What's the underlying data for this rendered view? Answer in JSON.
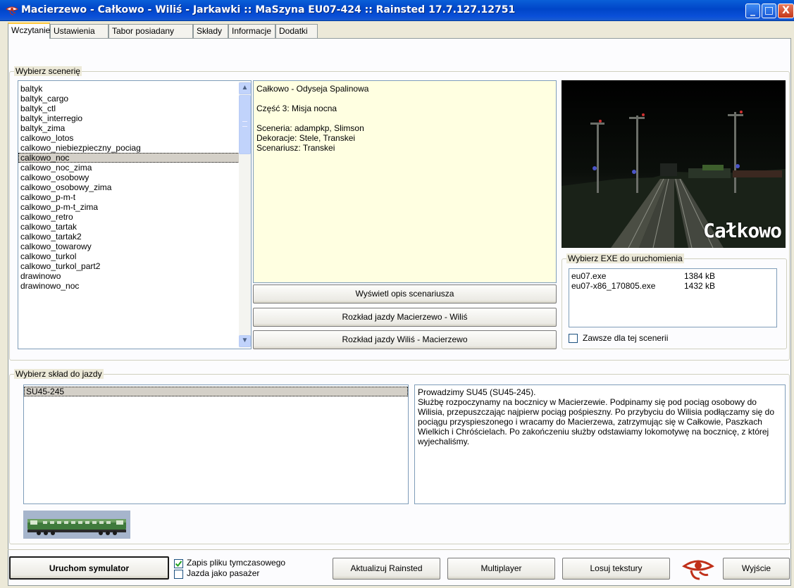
{
  "window": {
    "title": "Macierzewo - Całkowo - Wiliś - Jarkawki :: MaSzyna EU07-424 :: Rainsted 17.7.127.12751",
    "min_label": "_",
    "max_label": "□",
    "close_label": "X"
  },
  "tabs": [
    {
      "label": "Wczytanie",
      "active": true
    },
    {
      "label": "Ustawienia"
    },
    {
      "label": "Tabor posiadany"
    },
    {
      "label": "Składy"
    },
    {
      "label": "Informacje"
    },
    {
      "label": "Dodatki"
    }
  ],
  "scenery": {
    "group_label": "Wybierz scenerię",
    "items": [
      "baltyk",
      "baltyk_cargo",
      "baltyk_ctl",
      "baltyk_interregio",
      "baltyk_zima",
      "calkowo_lotos",
      "calkowo_niebiezpieczny_pociag",
      "calkowo_noc",
      "calkowo_noc_zima",
      "calkowo_osobowy",
      "calkowo_osobowy_zima",
      "calkowo_p-m-t",
      "calkowo_p-m-t_zima",
      "calkowo_retro",
      "calkowo_tartak",
      "calkowo_tartak2",
      "calkowo_towarowy",
      "calkowo_turkol",
      "calkowo_turkol_part2",
      "drawinowo",
      "drawinowo_noc"
    ],
    "selected": "calkowo_noc",
    "scroll_up": "▲",
    "scroll_down": "▼"
  },
  "description": {
    "text": "Całkowo - Odyseja Spalinowa\n\nCzęść 3: Misja nocna\n\nSceneria: adampkp, Slimson\nDekoracje: Stele, Transkei\nScenariusz: Transkei"
  },
  "scenario_buttons": {
    "show_desc": "Wyświetl opis scenariusza",
    "timetable_1": "Rozkład jazdy Macierzewo - Wiliś",
    "timetable_2": "Rozkład jazdy Wiliś - Macierzewo"
  },
  "preview": {
    "caption": "Całkowo"
  },
  "exe": {
    "group_label": "Wybierz EXE do uruchomienia",
    "items": [
      {
        "name": "eu07.exe",
        "size": "1384 kB"
      },
      {
        "name": "eu07-x86_170805.exe",
        "size": "1432 kB"
      }
    ],
    "always_label": "Zawsze dla tej scenerii",
    "always_checked": false
  },
  "composition": {
    "group_label": "Wybierz skład do jazdy",
    "items": [
      "SU45-245"
    ],
    "selected": "SU45-245",
    "description": "Prowadzimy SU45 (SU45-245).\nSłużbę rozpoczynamy na bocznicy w Macierzewie. Podpinamy się pod pociąg osobowy do Wilisia, przepuszczając najpierw pociąg pośpieszny. Po przybyciu do Wilisia podłączamy się do pociągu przyspieszonego i wracamy do Macierzewa, zatrzymując się w Całkowie, Paszkach Wielkich i Chróścielach. Po zakończeniu służby odstawiamy lokomotywę na bocznicę, z której wyjechaliśmy."
  },
  "bottom": {
    "run_label": "Uruchom symulator",
    "temp_file_label": "Zapis pliku tymczasowego",
    "temp_file_checked": true,
    "passenger_label": "Jazda jako pasażer",
    "passenger_checked": false,
    "update_label": "Aktualizuj Rainsted",
    "multiplayer_label": "Multiplayer",
    "random_textures_label": "Losuj tekstury",
    "exit_label": "Wyjście"
  },
  "colors": {
    "titlebar": "#0045c8",
    "desc_background": "#ffffe1",
    "selection": "#d4d0c8"
  }
}
